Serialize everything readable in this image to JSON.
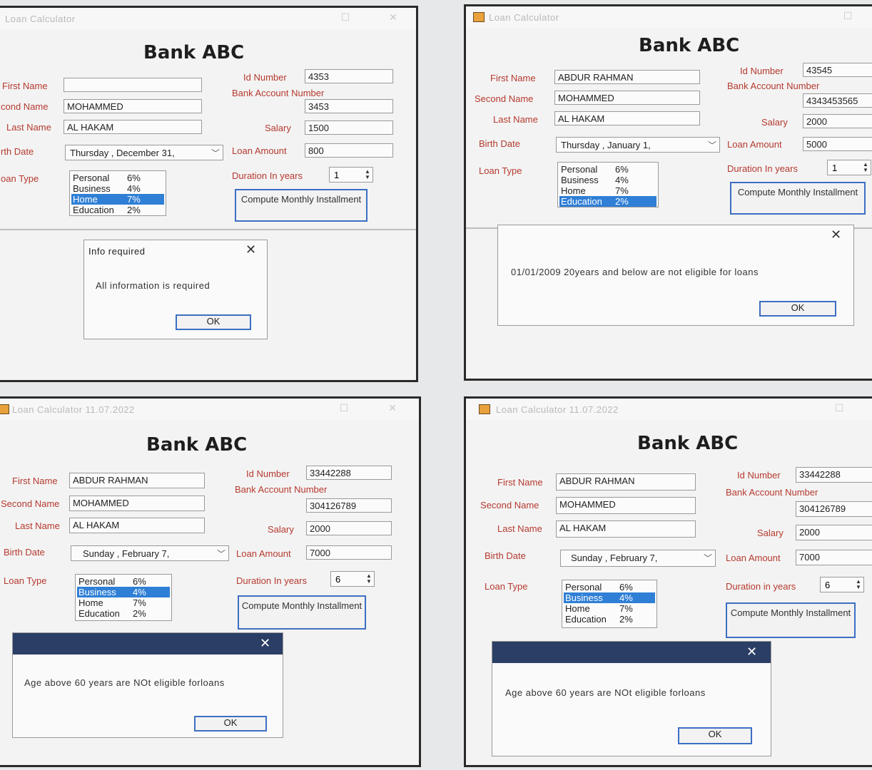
{
  "panels": [
    {
      "title": "Loan Calculator",
      "bank_name": "Bank ABC",
      "labels": {
        "first": "First Name",
        "second": "cond Name",
        "last": "Last Name",
        "birth": "rth Date",
        "loantype": "oan Type",
        "id": "Id Number",
        "bank_acc": "Bank Account Number",
        "salary": "Salary",
        "loan_amount": "Loan Amount",
        "duration": "Duration In years"
      },
      "values": {
        "first": "",
        "second": "MOHAMMED",
        "last": "AL HAKAM",
        "birth": "Thursday  ,  December  31,",
        "id": "4353",
        "bank_acc": "3453",
        "salary": "1500",
        "loan_amount": "800",
        "duration": "1"
      },
      "loan_types": [
        {
          "name": "Personal",
          "rate": "6%",
          "selected": false
        },
        {
          "name": "Business",
          "rate": "4%",
          "selected": false
        },
        {
          "name": "Home",
          "rate": "7%",
          "selected": true
        },
        {
          "name": "Education",
          "rate": "2%",
          "selected": false
        }
      ],
      "compute_button": "Compute Monthly Installment",
      "dialog": {
        "title": "Info  required",
        "message": "All information is required",
        "ok": "OK"
      }
    },
    {
      "title": "Loan Calculator",
      "bank_name": "Bank ABC",
      "labels": {
        "first": "First Name",
        "second": "Second Name",
        "last": "Last Name",
        "birth": "Birth Date",
        "loantype": "Loan Type",
        "id": "Id Number",
        "bank_acc": "Bank Account Number",
        "salary": "Salary",
        "loan_amount": "Loan Amount",
        "duration": "Duration In years"
      },
      "values": {
        "first": "ABDUR  RAHMAN",
        "second": "MOHAMMED",
        "last": "AL HAKAM",
        "birth": "Thursday  ,  January     1,",
        "id": "43545",
        "bank_acc": "4343453565",
        "salary": "2000",
        "loan_amount": "5000",
        "duration": "1"
      },
      "loan_types": [
        {
          "name": "Personal",
          "rate": "6%",
          "selected": false
        },
        {
          "name": "Business",
          "rate": "4%",
          "selected": false
        },
        {
          "name": "Home",
          "rate": "7%",
          "selected": false
        },
        {
          "name": "Education",
          "rate": "2%",
          "selected": true
        }
      ],
      "compute_button": "Compute Monthly Installment",
      "dialog": {
        "title": "",
        "message": "01/01/2009  20years and below are not eligible for loans",
        "ok": "OK"
      }
    },
    {
      "title": "Loan Calculator  11.07.2022",
      "bank_name": "Bank ABC",
      "labels": {
        "first": "First Name",
        "second": "Second Name",
        "last": "Last Name",
        "birth": "Birth Date",
        "loantype": "Loan Type",
        "id": "Id Number",
        "bank_acc": "Bank Account Number",
        "salary": "Salary",
        "loan_amount": "Loan Amount",
        "duration": "Duration In years"
      },
      "values": {
        "first": "ABDUR RAHMAN",
        "second": "MOHAMMED",
        "last": "AL HAKAM",
        "birth": "Sunday    ,  February    7,",
        "id": "33442288",
        "bank_acc": "304126789",
        "salary": "2000",
        "loan_amount": "7000",
        "duration": "6"
      },
      "loan_types": [
        {
          "name": "Personal",
          "rate": "6%",
          "selected": false
        },
        {
          "name": "Business",
          "rate": "4%",
          "selected": true
        },
        {
          "name": "Home",
          "rate": "7%",
          "selected": false
        },
        {
          "name": "Education",
          "rate": "2%",
          "selected": false
        }
      ],
      "compute_button": "Compute Monthly Installment",
      "dialog": {
        "title": "",
        "message": "Age above 60 years are NOt eligible forloans",
        "ok": "OK"
      }
    },
    {
      "title": "Loan Calculator  11.07.2022",
      "bank_name": "Bank ABC",
      "labels": {
        "first": "First Name",
        "second": "Second Name",
        "last": "Last Name",
        "birth": "Birth Date",
        "loantype": "Loan Type",
        "id": "Id Number",
        "bank_acc": "Bank Account Number",
        "salary": "Salary",
        "loan_amount": "Loan Amount",
        "duration": "Duration in years"
      },
      "values": {
        "first": "ABDUR RAHMAN",
        "second": "MOHAMMED",
        "last": "AL HAKAM",
        "birth": "Sunday   ,  February    7,",
        "id": "33442288",
        "bank_acc": "304126789",
        "salary": "2000",
        "loan_amount": "7000",
        "duration": "6"
      },
      "loan_types": [
        {
          "name": "Personal",
          "rate": "6%",
          "selected": false
        },
        {
          "name": "Business",
          "rate": "4%",
          "selected": true
        },
        {
          "name": "Home",
          "rate": "7%",
          "selected": false
        },
        {
          "name": "Education",
          "rate": "2%",
          "selected": false
        }
      ],
      "compute_button": "Compute Monthly Installment",
      "dialog": {
        "title": "",
        "message": "Age above 60 years are NOt eligible forloans",
        "ok": "OK"
      }
    }
  ],
  "colors": {
    "label_red": "#b53a2f",
    "selection_blue": "#2f7fd6",
    "dialog_bar": "#2b3e66",
    "button_border": "#3c6fc4"
  }
}
